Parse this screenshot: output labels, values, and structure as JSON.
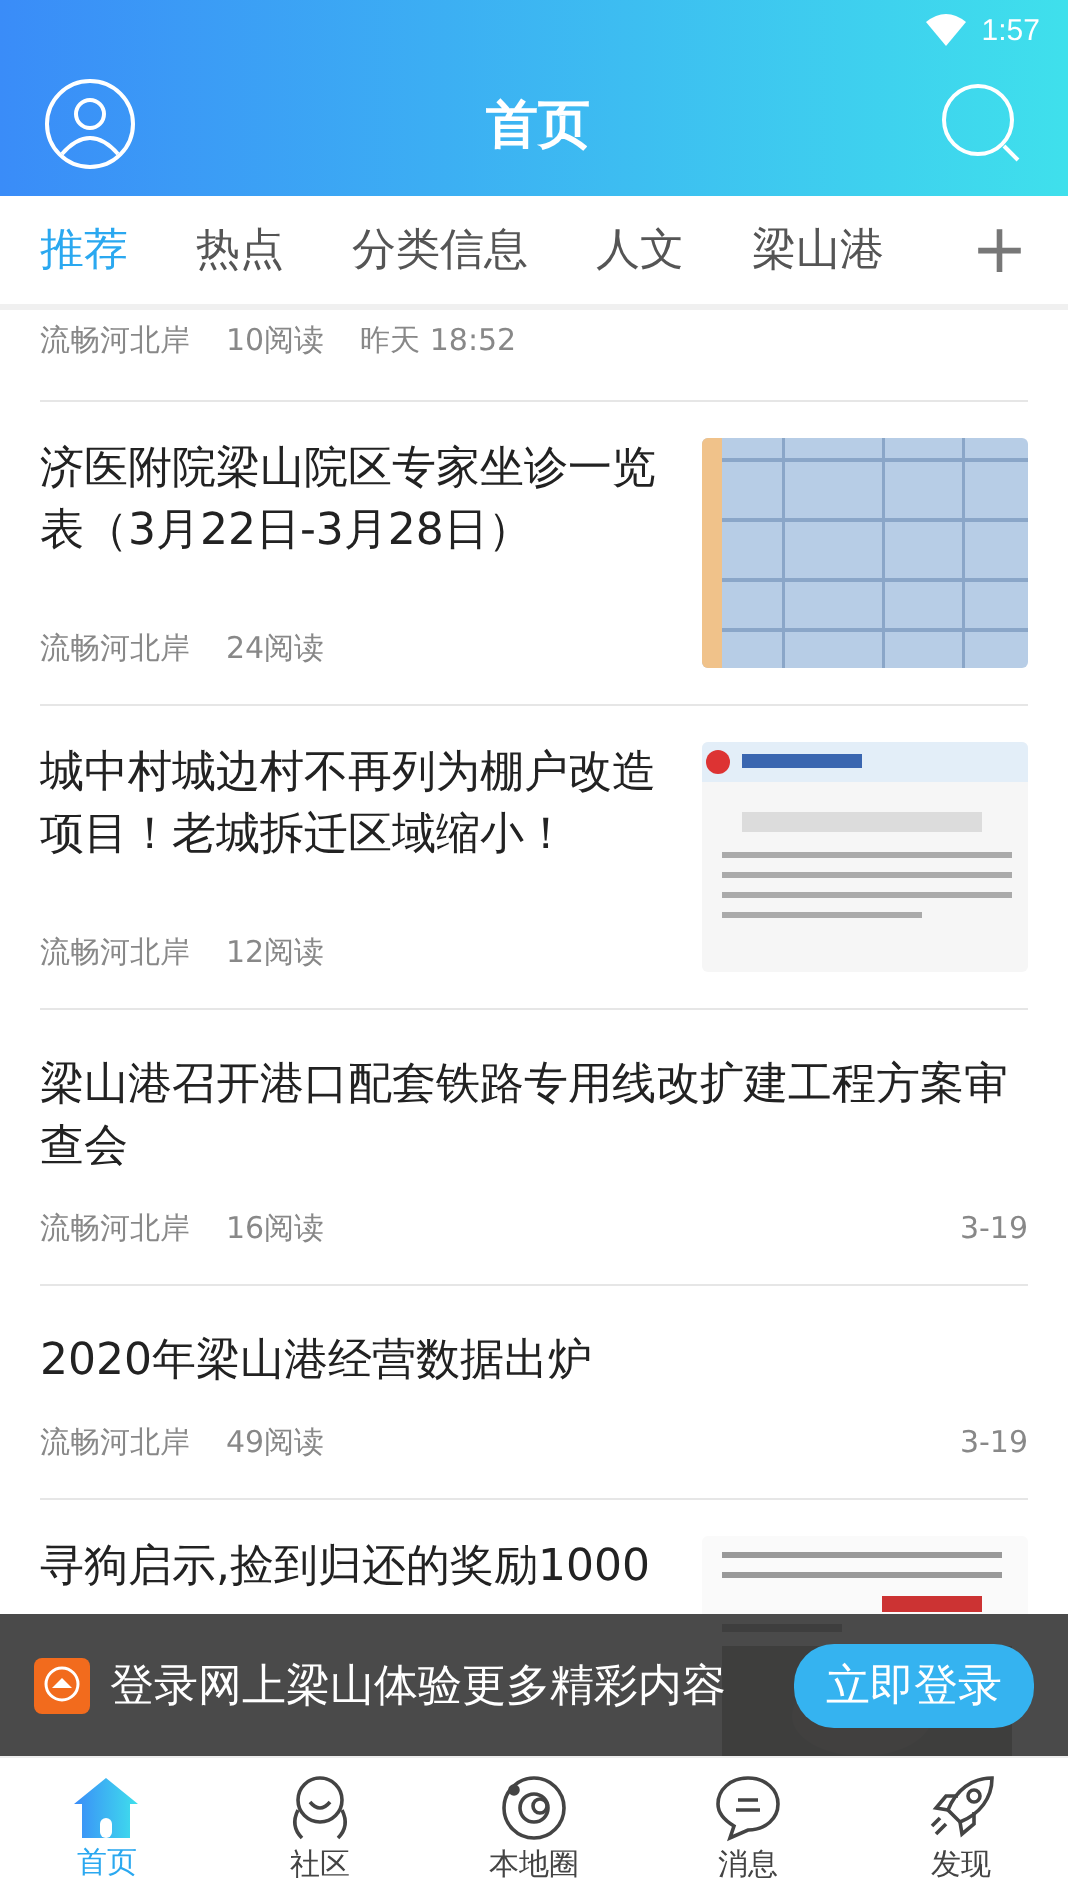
{
  "status_bar": {
    "time": "1:57"
  },
  "header": {
    "title": "首页"
  },
  "tabs": [
    {
      "label": "推荐",
      "selected": true
    },
    {
      "label": "热点",
      "selected": false
    },
    {
      "label": "分类信息",
      "selected": false
    },
    {
      "label": "人文",
      "selected": false
    },
    {
      "label": "梁山港",
      "selected": false
    }
  ],
  "add_tab": "+",
  "feed": [
    {
      "kind": "meta",
      "source": "流畅河北岸",
      "reads": "10阅读",
      "time": "昨天 18:52"
    },
    {
      "kind": "thumb",
      "title": "济医附院梁山院区专家坐诊一览表（3月22日-3月28日）",
      "source": "流畅河北岸",
      "reads": "24阅读"
    },
    {
      "kind": "thumb",
      "title": "城中村城边村不再列为棚户改造项目！老城拆迁区域缩小！",
      "source": "流畅河北岸",
      "reads": "12阅读"
    },
    {
      "kind": "text",
      "title": "梁山港召开港口配套铁路专用线改扩建工程方案审查会",
      "source": "流畅河北岸",
      "reads": "16阅读",
      "time": "3-19"
    },
    {
      "kind": "text",
      "title": "2020年梁山港经营数据出炉",
      "source": "流畅河北岸",
      "reads": "49阅读",
      "time": "3-19"
    },
    {
      "kind": "thumb",
      "title": "寻狗启示,捡到归还的奖励1000"
    }
  ],
  "login_banner": {
    "text": "登录网上梁山体验更多精彩内容",
    "button": "立即登录"
  },
  "bottom_nav": [
    {
      "label": "首页",
      "selected": true
    },
    {
      "label": "社区",
      "selected": false
    },
    {
      "label": "本地圈",
      "selected": false
    },
    {
      "label": "消息",
      "selected": false
    },
    {
      "label": "发现",
      "selected": false
    }
  ]
}
